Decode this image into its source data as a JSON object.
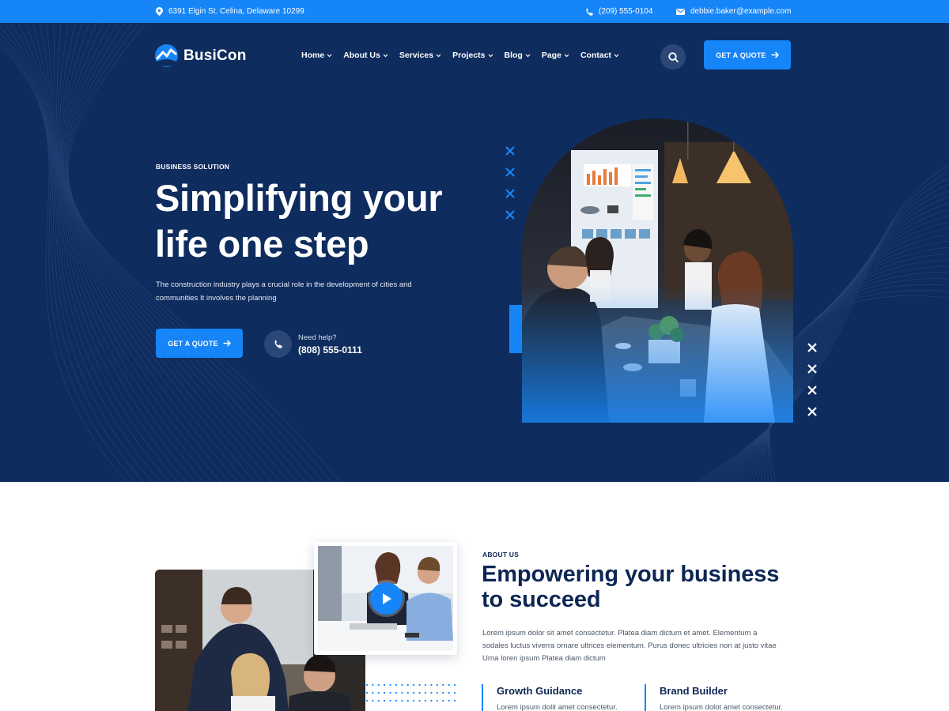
{
  "topbar": {
    "address": "6391 Elgin St. Celina, Delaware 10299",
    "phone": "(209) 555-0104",
    "email": "debbie.baker@example.com"
  },
  "brand": {
    "name": "BusiCon"
  },
  "nav": {
    "items": [
      {
        "label": "Home"
      },
      {
        "label": "About Us"
      },
      {
        "label": "Services"
      },
      {
        "label": "Projects"
      },
      {
        "label": "Blog"
      },
      {
        "label": "Page"
      },
      {
        "label": "Contact"
      }
    ],
    "cta_label": "GET A QUOTE"
  },
  "hero": {
    "eyebrow": "BUSINESS SOLUTION",
    "title_line1": "Simplifying your",
    "title_line2": "life one step",
    "desc_line1": "The construction industry plays a crucial role in the development of cities and",
    "desc_line2": "communities It involves the planning",
    "cta_label": "GET A QUOTE",
    "help_label": "Need help?",
    "help_phone": "(808) 555-0111"
  },
  "about": {
    "eyebrow": "ABOUT US",
    "title_line1": "Empowering your business",
    "title_line2": "to succeed",
    "desc_line1": "Lorem ipsum dolor sit amet consectetur. Platea diam dictum et amet. Elementum a",
    "desc_line2": "sodales luctus viverra ornare ultrices elementum. Purus donec ultricies non at justo vitae",
    "desc_line3": "Urna loren ipsum Platea diam dictum",
    "features": [
      {
        "title": "Growth Guidance",
        "text": "Lorem ipsum dolit amet consectetur."
      },
      {
        "title": "Brand Builder",
        "text": "Lorem ipsum dolot amet consectetur."
      }
    ]
  },
  "colors": {
    "accent": "#1685f8",
    "hero_bg": "#0f2c5e",
    "heading": "#0d2654"
  },
  "icons": [
    "location-pin-icon",
    "phone-icon",
    "envelope-icon",
    "logo-mark-icon",
    "chevron-down-icon",
    "search-icon",
    "arrow-right-icon",
    "close-x-icon",
    "play-icon"
  ]
}
